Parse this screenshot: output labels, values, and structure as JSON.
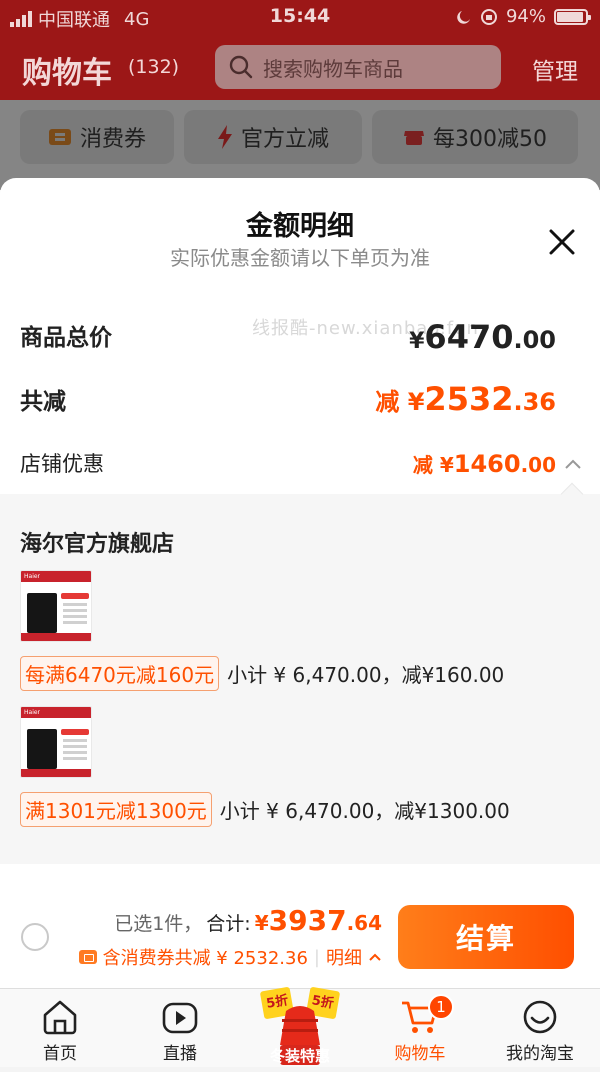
{
  "status_bar": {
    "carrier": "中国联通",
    "network": "4G",
    "time": "15:44",
    "battery": "94%",
    "battery_level": 0.94
  },
  "header": {
    "title": "购物车",
    "count": "(132)",
    "search_placeholder": "搜索购物车商品",
    "manage": "管理"
  },
  "filters": [
    {
      "label": "消费券",
      "icon": "coupon-icon"
    },
    {
      "label": "官方立减",
      "icon": "lightning-icon"
    },
    {
      "label": "每300减50",
      "icon": "shop-icon"
    }
  ],
  "sheet": {
    "title": "金额明细",
    "subtitle": "实际优惠金额请以下单页为准",
    "watermark": "线报酷-new.xianbao.fun",
    "total_label": "商品总价",
    "total_currency": "¥",
    "total_int": "6470",
    "total_dec": ".00",
    "discount_label": "共减",
    "discount_prefix": "减 ¥",
    "discount_int": "2532",
    "discount_dec": ".36",
    "shop_discount_label": "店铺优惠",
    "shop_discount_prefix": "减 ¥",
    "shop_discount_int": "1460",
    "shop_discount_dec": ".00"
  },
  "detail": {
    "shop_name": "海尔官方旗舰店",
    "items": [
      {
        "brand": "Haier",
        "promo_tag": "每满6470元减160元",
        "subtotal": "小计 ¥ 6,470.00，减¥160.00"
      },
      {
        "brand": "Haier",
        "promo_tag": "满1301元减1300元",
        "subtotal": "小计 ¥ 6,470.00，减¥1300.00"
      }
    ]
  },
  "checkout": {
    "selected": "已选1件，",
    "total_label": "合计:",
    "total_currency": "¥",
    "total_int": "3937",
    "total_dec": ".64",
    "discount_text": "含消费券共减 ¥ 2532.36",
    "detail_link": "明细",
    "button": "结算"
  },
  "tabbar": {
    "home": "首页",
    "live": "直播",
    "promo_top": "5折",
    "promo_label": "冬装特惠",
    "cart": "购物车",
    "cart_badge": "1",
    "mine": "我的淘宝"
  },
  "colors": {
    "accent": "#ff5000",
    "header_red": "#9c1717"
  }
}
